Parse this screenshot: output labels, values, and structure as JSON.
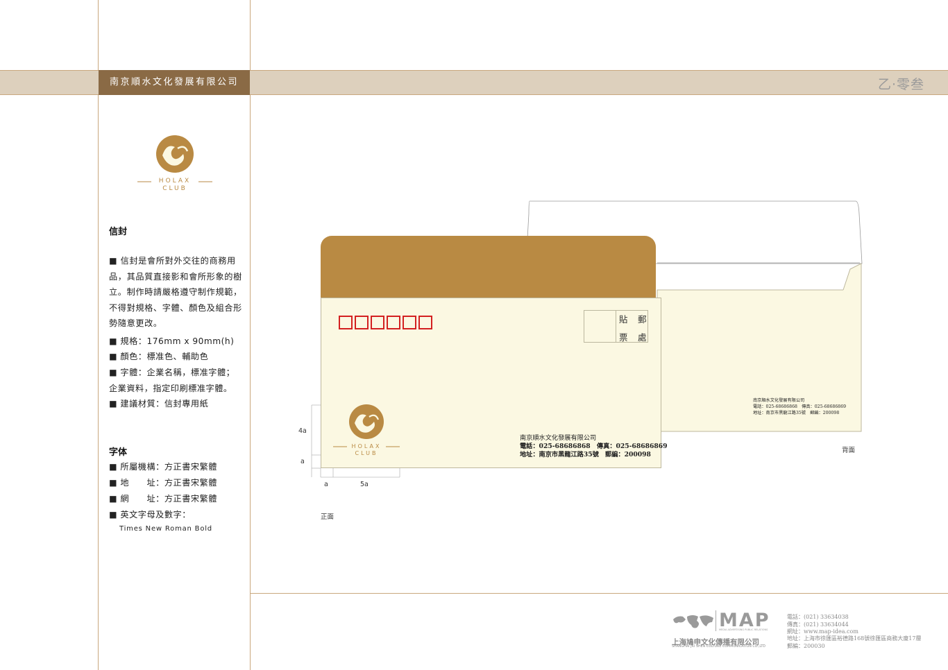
{
  "header": {
    "company_name": "南京順水文化發展有限公司",
    "page_code": "乙·零叁"
  },
  "logo": {
    "line1": "HOLAX",
    "line2": "CLUB",
    "color": "#b98a43"
  },
  "sidebar": {
    "section1_title": "信封",
    "description": "■ 信封是會所對外交往的商務用品，其品質直接影和會所形象的樹立。制作時請嚴格遵守制作規範，不得對規格、字體、顏色及組合形勢隨意更改。",
    "spec": "■ 規格：176mm x 90mm(h)",
    "color_line": "■ 顏色：標准色、輔助色",
    "font_line1": "■ 字體：企業名稱，標准字體；",
    "font_line2": "企業資料，指定印刷標准字體。",
    "material": "■ 建議材質：信封專用紙",
    "section2_title": "字体",
    "font_org": "■ 所屬機構：方正書宋繁體",
    "font_addr": "■ 地　　址：方正書宋繁體",
    "font_web": "■ 網　　址：方正書宋繁體",
    "font_en_label": "■ 英文字母及數字：",
    "font_en_value": "Times New Roman Bold"
  },
  "envelope": {
    "stamp_chars": [
      "貼",
      "郵",
      "票",
      "處"
    ],
    "front_company": "南京順水文化發展有限公司",
    "front_phone": "電話：025-68686868　傳真：025-68686869",
    "front_address": "地址：南京市黑龍江路35號　郵編：200098",
    "back_company": "南京順水文化發展有限公司",
    "back_phone": "電話：025-68686868　傳真：025-68686869",
    "back_address": "地址：南京市黑龍江路35號　郵編：200098",
    "label_front": "正面",
    "label_back": "背面",
    "dim_4a": "4a",
    "dim_a_v": "a",
    "dim_a_h": "a",
    "dim_5a": "5a",
    "flap_color": "#b98a43",
    "paper_color": "#fbf8e2",
    "zip_color": "#d32020"
  },
  "footer": {
    "brand": "MAP",
    "brand_sub": "MEDIA ADVERTISING PUBLIC RELATIONS",
    "company_cn": "上海鳩申文化傳播有限公司",
    "company_en": "SHANGHAI JIU SHEN CULTURE COMMUNICATION CO.,LTD",
    "phone": "電話：(021) 33634038",
    "fax": "傳真：(021) 33634044",
    "web": "網址：www.map-idea.com",
    "address": "地址：上海市徐匯區裕德路168號徐匯區商務大廈17層",
    "zip": "郵編：200030"
  }
}
